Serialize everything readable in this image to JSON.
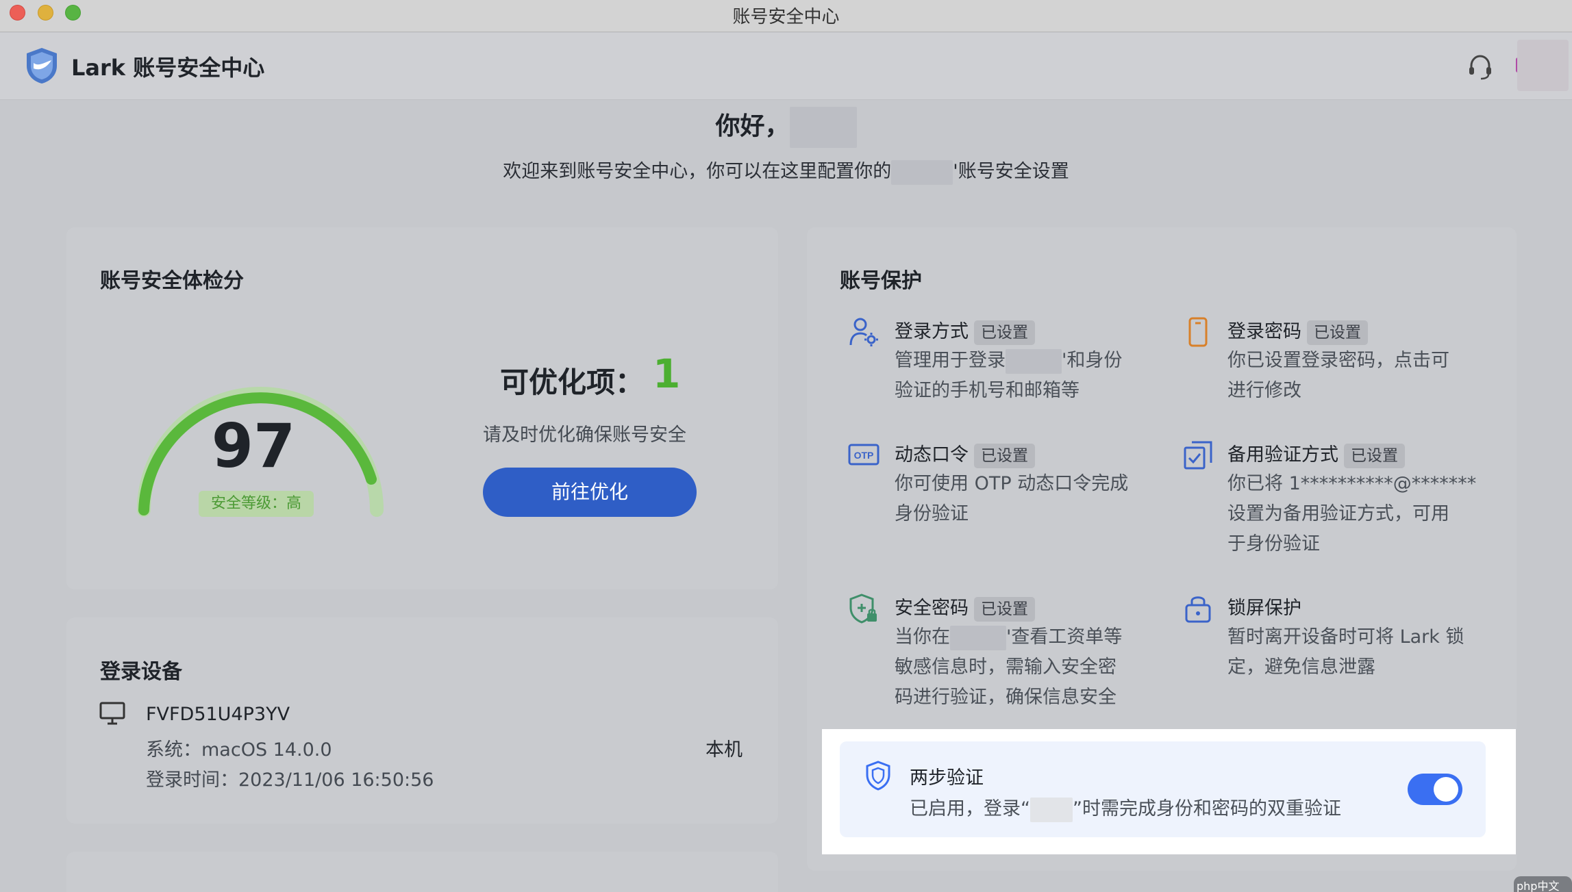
{
  "window": {
    "title": "账号安全中心"
  },
  "header": {
    "brand": "Lark 账号安全中心"
  },
  "greeting": {
    "hello": "你好，",
    "subtitle_pre": "欢迎来到账号安全中心，你可以在这里配置你的",
    "subtitle_post": "'账号安全设置"
  },
  "score_card": {
    "title": "账号安全体检分",
    "score": "97",
    "level": "安全等级：高",
    "optimize_label": "可优化项：",
    "optimize_count": "1",
    "optimize_hint": "请及时优化确保账号安全",
    "optimize_button": "前往优化"
  },
  "devices_card": {
    "title": "登录设备",
    "device_name": "FVFD51U4P3YV",
    "system": "系统：macOS 14.0.0",
    "login_time": "登录时间：2023/11/06 16:50:56",
    "local": "本机"
  },
  "protection": {
    "title": "账号保护",
    "items": [
      {
        "title": "登录方式",
        "badge": "已设置",
        "desc1a": "管理用于登录",
        "desc1b": "'和身份",
        "desc2": "验证的手机号和邮箱等"
      },
      {
        "title": "登录密码",
        "badge": "已设置",
        "desc1": "你已设置登录密码，点击可",
        "desc2": "进行修改"
      },
      {
        "title": "动态口令",
        "badge": "已设置",
        "desc1": "你可使用 OTP 动态口令完成",
        "desc2": "身份验证"
      },
      {
        "title": "备用验证方式",
        "badge": "已设置",
        "desc1": "你已将 1**********@*******",
        "desc2": "设置为备用验证方式，可用",
        "desc3": "于身份验证"
      },
      {
        "title": "安全密码",
        "badge": "已设置",
        "desc1a": "当你在",
        "desc1b": "'查看工资单等",
        "desc2": "敏感信息时，需输入安全密",
        "desc3": "码进行验证，确保信息安全"
      },
      {
        "title": "锁屏保护",
        "desc1": "暂时离开设备时可将 Lark 锁",
        "desc2": "定，避免信息泄露"
      }
    ],
    "two_step": {
      "title": "两步验证",
      "desc_pre": "已启用，登录“",
      "desc_post": "”时需完成身份和密码的双重验证",
      "enabled": true
    }
  },
  "watermark": "php中文网",
  "colors": {
    "accent": "#2f5ec6",
    "success": "#4caf31",
    "toggle": "#3a6ff2"
  }
}
